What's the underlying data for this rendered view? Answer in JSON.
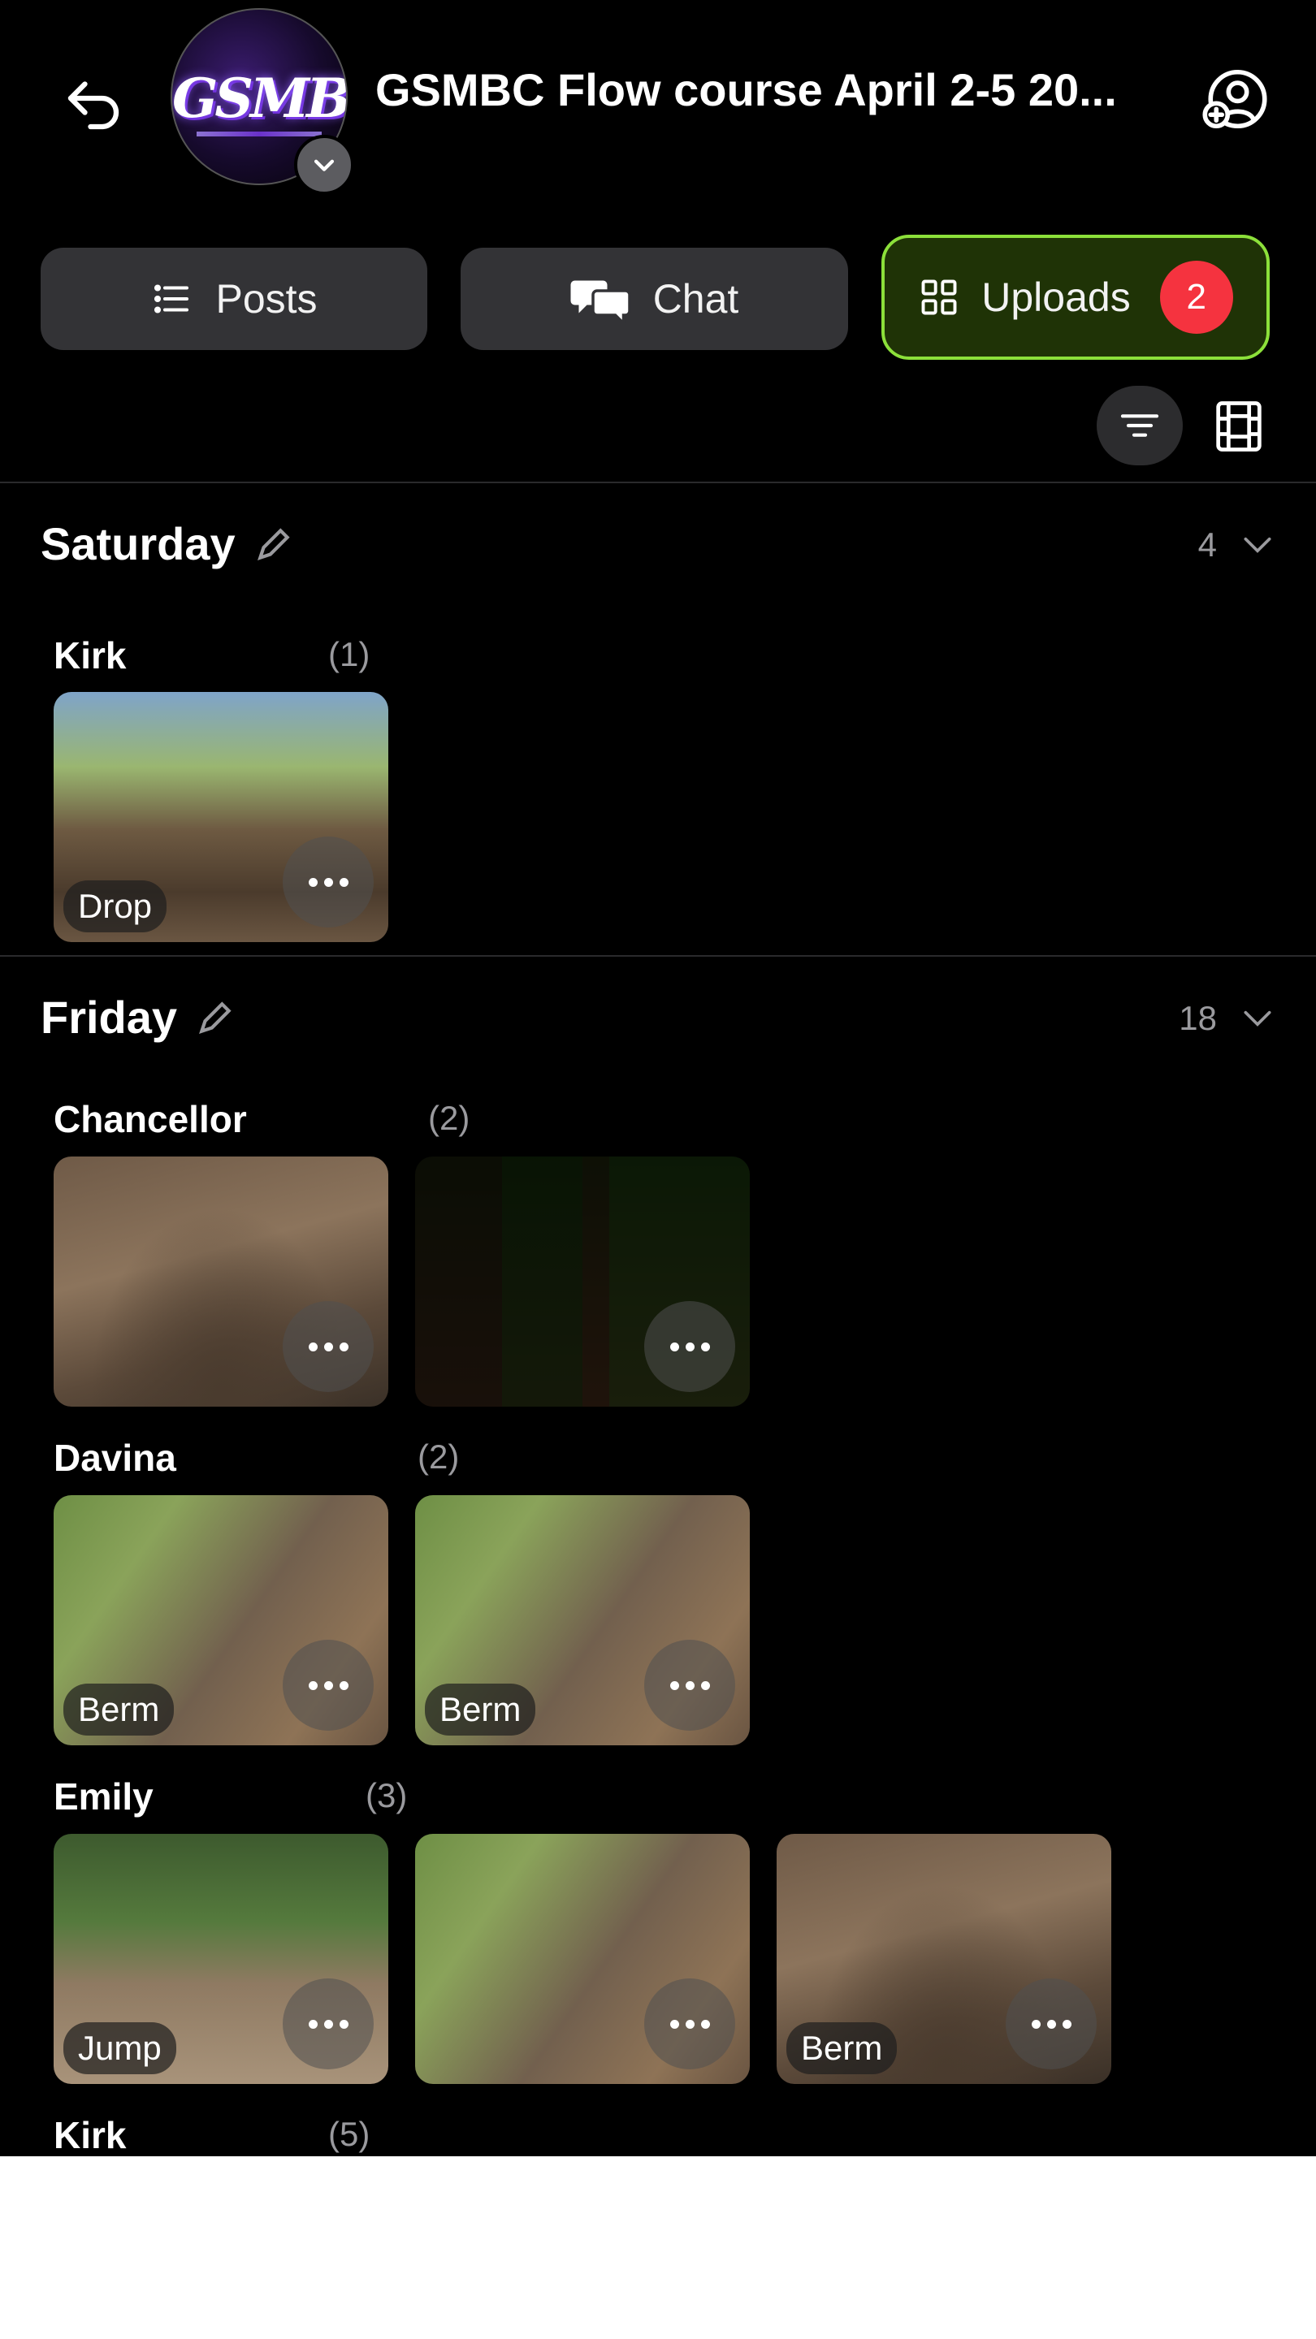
{
  "header": {
    "title": "GSMBC Flow course April 2-5 20...",
    "group_logo_text": "GSMBC"
  },
  "tabs": [
    {
      "label": "Posts"
    },
    {
      "label": "Chat"
    },
    {
      "label": "Uploads",
      "badge": "2"
    }
  ],
  "colors": {
    "accent_green": "#8ce03a",
    "badge_red": "#f5333f"
  },
  "sections": [
    {
      "title": "Saturday",
      "count": "4",
      "people": [
        {
          "name": "Kirk",
          "count": "(1)",
          "items": [
            {
              "tag": "Drop"
            }
          ]
        }
      ]
    },
    {
      "title": "Friday",
      "count": "18",
      "people": [
        {
          "name": "Chancellor",
          "count": "(2)",
          "items": [
            {
              "tag": ""
            },
            {
              "tag": ""
            }
          ]
        },
        {
          "name": "Davina",
          "count": "(2)",
          "items": [
            {
              "tag": "Berm"
            },
            {
              "tag": "Berm"
            }
          ]
        },
        {
          "name": "Emily",
          "count": "(3)",
          "items": [
            {
              "tag": "Jump"
            },
            {
              "tag": ""
            },
            {
              "tag": "Berm"
            }
          ]
        },
        {
          "name": "Kirk",
          "count": "(5)",
          "items": []
        }
      ]
    }
  ]
}
